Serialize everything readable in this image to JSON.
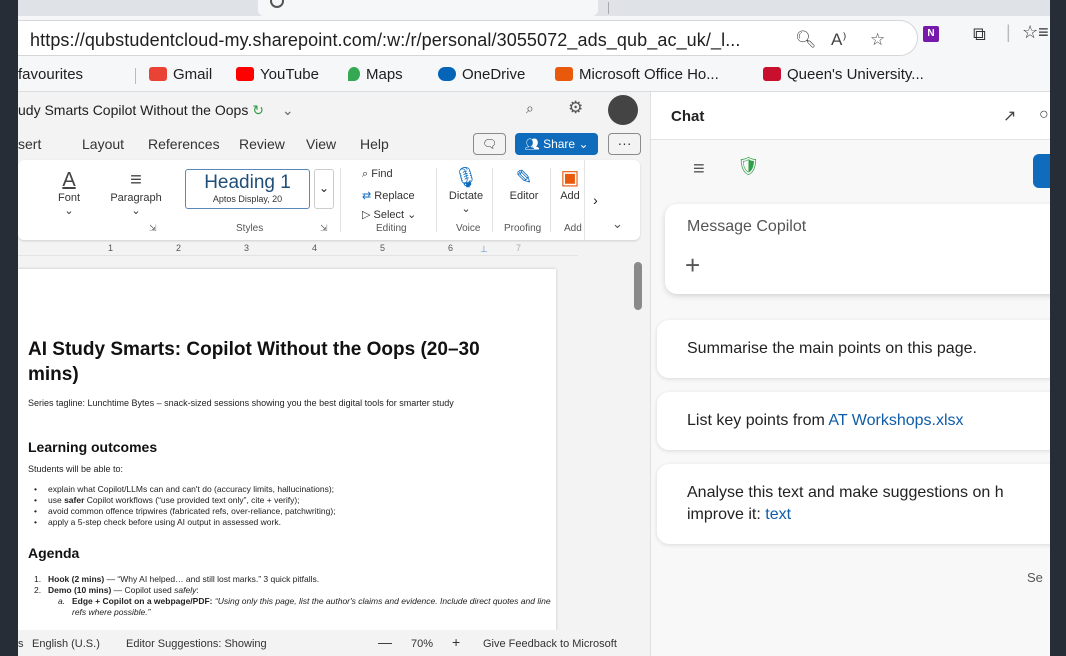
{
  "browser": {
    "url": "https://qubstudentcloud-my.sharepoint.com/:w:/r/personal/3055072_ads_qub_ac_uk/_l...",
    "favourites_label": "favourites",
    "bookmarks": [
      {
        "label": "Gmail",
        "color": "#ea4335"
      },
      {
        "label": "YouTube",
        "color": "#ff0000"
      },
      {
        "label": "Maps",
        "color": "#34a853"
      },
      {
        "label": "OneDrive",
        "color": "#0364b8"
      },
      {
        "label": "Microsoft Office Ho...",
        "color": "#e8590c"
      },
      {
        "label": "Queen's University...",
        "color": "#c8102e"
      }
    ]
  },
  "word": {
    "doc_title": "udy Smarts Copilot Without the Oops",
    "menu": [
      "sert",
      "Layout",
      "References",
      "Review",
      "View",
      "Help"
    ],
    "share_label": "Share",
    "ribbon": {
      "font": "Font",
      "paragraph": "Paragraph",
      "style_name": "Heading 1",
      "style_sub": "Aptos Display, 20",
      "styles": "Styles",
      "find": "Find",
      "replace": "Replace",
      "select": "Select",
      "editing": "Editing",
      "dictate": "Dictate",
      "voice": "Voice",
      "editor": "Editor",
      "proofing": "Proofing",
      "add": "Add",
      "add_label": "Add"
    },
    "ruler": [
      "1",
      "2",
      "3",
      "4",
      "5",
      "6",
      "7"
    ],
    "document": {
      "title": "AI Study Smarts: Copilot Without the Oops (20–30 mins)",
      "tagline": "Series tagline: Lunchtime Bytes – snack-sized sessions showing you the best digital tools for smarter study",
      "outcomes_heading": "Learning outcomes",
      "outcomes_intro": "Students will be able to:",
      "outcomes": [
        "explain what Copilot/LLMs can and can't do (accuracy limits, hallucinations);",
        "use safer Copilot workflows (“use provided text only”, cite + verify);",
        "avoid common offence tripwires (fabricated refs, over-reliance, patchwriting);",
        "apply a 5-step check before using AI output in assessed work."
      ],
      "agenda_heading": "Agenda",
      "agenda": [
        "Hook (2 mins) — “Why AI helped… and still lost marks.” 3 quick pitfalls.",
        "Demo (10 mins) — Copilot used safely:"
      ],
      "agenda_sub": "Edge + Copilot on a webpage/PDF: “Using only this page, list the author's claims and evidence. Include direct quotes and line refs where possible.”"
    },
    "status": {
      "language": "English (U.S.)",
      "editor_suggestions": "Editor Suggestions: Showing",
      "zoom": "70%",
      "feedback": "Give Feedback to Microsoft"
    }
  },
  "chat": {
    "title": "Chat",
    "composer_placeholder": "Message Copilot",
    "suggestions": [
      {
        "text": "Summarise the main points on this page.",
        "link": ""
      },
      {
        "text": "List key points from ",
        "link": "AT Workshops.xlsx"
      },
      {
        "text": "Analyse this text and make suggestions on h improve it: ",
        "link": "text"
      }
    ],
    "see_more": "Se"
  }
}
